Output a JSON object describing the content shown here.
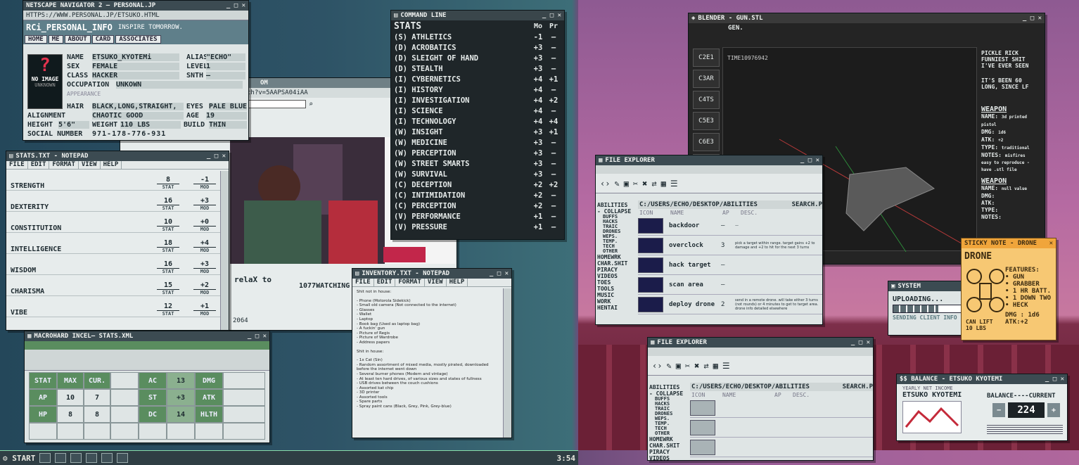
{
  "navigator": {
    "title": "NETSCAPE NAVIGATOR 2 — PERSONAL.JP",
    "url": "HTTPS://WWW.PERSONAL.JP/ETSUKO.HTML",
    "site": "RCi_PERSONAL_INFO",
    "tagline": "INSPIRE TOMORROW.",
    "nav": [
      "HOME",
      "ME",
      "ABOUT",
      "CARD",
      "ASSOCIATES"
    ],
    "noimage": "?",
    "noimage_label": "NO IMAGE",
    "unknown": "UNKNOWN",
    "fields": [
      {
        "k": "NAME",
        "v": "ETSUKO_KYOTEMi"
      },
      {
        "k": "SEX",
        "v": "FEMALE"
      },
      {
        "k": "CLASS",
        "v": "HACKER"
      },
      {
        "k": "OCCUPATION",
        "v": "UNKOWN"
      }
    ],
    "right_fields": [
      {
        "k": "ALIAS",
        "v": "\"ECHO\""
      },
      {
        "k": "LEVEL",
        "v": "1"
      },
      {
        "k": "SNTH",
        "v": "—"
      }
    ],
    "appearance": "APPEARANCE",
    "hair_k": "HAIR",
    "hair_v": "BLACK,LONG,STRAIGHT,",
    "eyes_k": "EYES",
    "eyes_v": "PALE BLUE",
    "align_k": "ALIGNMENT",
    "align_v": "CHAOTIC GOOD",
    "age_k": "AGE",
    "age_v": "19",
    "height_k": "HEIGHT",
    "height_v": "5'6\"",
    "weight_k": "WEIGHT",
    "weight_v": "110 LBS",
    "build_k": "BUILD",
    "build_v": "THIN",
    "social_k": "SOCIAL NUMBER",
    "social_v": "971-178-776-931"
  },
  "browser2": {
    "url": "ch?v=5AAPSA04iAA",
    "caption": "relaX to",
    "watching": "1077WATCHING",
    "views": "2064",
    "title_frag": "OM"
  },
  "notepad": {
    "title": "STATS.TXT - NOTEPAD",
    "menu": [
      "FILE",
      "EDIT",
      "FORMAT",
      "VIEW",
      "HELP"
    ],
    "stat_lbl": "STAT",
    "mod_lbl": "MOD",
    "rows": [
      {
        "n": "STRENGTH",
        "v": "8",
        "m": "-1"
      },
      {
        "n": "DEXTERITY",
        "v": "16",
        "m": "+3"
      },
      {
        "n": "CONSTITUTION",
        "v": "10",
        "m": "+0"
      },
      {
        "n": "INTELLIGENCE",
        "v": "18",
        "m": "+4"
      },
      {
        "n": "WISDOM",
        "v": "16",
        "m": "+3"
      },
      {
        "n": "CHARISMA",
        "v": "15",
        "m": "+2"
      },
      {
        "n": "VIBE",
        "v": "12",
        "m": "+1"
      }
    ]
  },
  "cmd": {
    "title": "COMMAND LINE",
    "head": "STATS",
    "col1": "Mo",
    "col2": "Pr",
    "rows": [
      {
        "n": "(S) ATHLETICS",
        "m": "-1",
        "p": "—"
      },
      {
        "n": "(D) ACROBATICS",
        "m": "+3",
        "p": "—"
      },
      {
        "n": "(D) SLEIGHT OF HAND",
        "m": "+3",
        "p": "—"
      },
      {
        "n": "(D) STEALTH",
        "m": "+3",
        "p": "—"
      },
      {
        "n": "(I) CYBERNETICS",
        "m": "+4",
        "p": "+1"
      },
      {
        "n": "(I) HISTORY",
        "m": "+4",
        "p": "—"
      },
      {
        "n": "(I) INVESTIGATION",
        "m": "+4",
        "p": "+2"
      },
      {
        "n": "(I) SCIENCE",
        "m": "+4",
        "p": "—"
      },
      {
        "n": "(I) TECHNOLOGY",
        "m": "+4",
        "p": "+4"
      },
      {
        "n": "(W) INSIGHT",
        "m": "+3",
        "p": "+1"
      },
      {
        "n": "(W) MEDICINE",
        "m": "+3",
        "p": "—"
      },
      {
        "n": "(W) PERCEPTION",
        "m": "+3",
        "p": "—"
      },
      {
        "n": "(W) STREET SMARTS",
        "m": "+3",
        "p": "—"
      },
      {
        "n": "(W) SURVIVAL",
        "m": "+3",
        "p": "—"
      },
      {
        "n": "(C) DECEPTION",
        "m": "+2",
        "p": "+2"
      },
      {
        "n": "(C) INTIMIDATION",
        "m": "+2",
        "p": "—"
      },
      {
        "n": "(C) PERCEPTION",
        "m": "+2",
        "p": "—"
      },
      {
        "n": "(V) PERFORMANCE",
        "m": "+1",
        "p": "—"
      },
      {
        "n": "(V) PRESSURE",
        "m": "+1",
        "p": "—"
      }
    ]
  },
  "inventory": {
    "title": "INVENTORY.TXT - NOTEPAD",
    "menu": [
      "FILE",
      "EDIT",
      "FORMAT",
      "VIEW",
      "HELP"
    ],
    "lines": [
      "Shit not in house:",
      "",
      "- Phone (Motorola Sidekick)",
      "- Small old camera (Not connected to the internet)",
      "- Glasses",
      "- Wallet",
      "- Laptop",
      "- Book bag (Used as laptop bag)",
      "- A fuckin' gun",
      "- Picture of Regis",
      "- Picture of Wardrobe",
      "- Address papers",
      "",
      "Shit in house:",
      "",
      "- 1x Cat (Sin)",
      "- Random assortment of mixed media, mostly pirated, downloaded before the internet went down",
      "- Several burner phones (Modern and vintage)",
      "- At least ten hard drives, of various sizes and states of fullness",
      "- USB drives between the couch cushions",
      "- Assorted kat chip",
      "- 3D printer",
      "- Assorted tools",
      "- Spare parts",
      "- Spray paint cans (Black, Grey, Pink, Grey-blue)"
    ]
  },
  "spreadsheet": {
    "title": "MACROHARD INCEL— STATS.XML",
    "headers": [
      "STAT",
      "MAX",
      "CUR."
    ],
    "rows": [
      [
        "AP",
        "10",
        "7"
      ],
      [
        "HP",
        "8",
        "8"
      ]
    ],
    "right": [
      [
        "AC",
        "13",
        "DMG"
      ],
      [
        "ST",
        "+3",
        "ATK"
      ],
      [
        "DC",
        "14",
        "HLTH"
      ]
    ]
  },
  "taskbar": {
    "start": "START",
    "time": "3:54"
  },
  "blender": {
    "title": "BLENDER - GUN.STL",
    "gen": "GEN.",
    "time": "TIME10976942",
    "notes": [
      "PICKLE RICK",
      "FUNNIEST SHIT",
      "I'VE EVER SEEN",
      "IT'S BEEN 60",
      "LONG, SINCE LF"
    ],
    "side": [
      "C2E1",
      "C3AR",
      "C4TS",
      "C5E3",
      "C6E3",
      "C7RS",
      "C8RF",
      "C9E3",
      "C5E1"
    ],
    "w1": {
      "h": "WEAPON",
      "name": "3d printed pistol",
      "dmg": "1d6",
      "atk": "+2",
      "type": "traditional",
      "notes": "misfires"
    },
    "w1_extra": [
      "easy to reproduce -",
      "have .stl file"
    ],
    "w2": {
      "h": "WEAPON",
      "name": "null value"
    },
    "field_labels": [
      "NAME:",
      "DMG:",
      "ATK:",
      "TYPE:",
      "NOTES:"
    ]
  },
  "fe1": {
    "title": "FILE EXPLORER",
    "path": "C:/USERS/ECHO/DESKTOP/ABILITIES",
    "search": "SEARCH.P",
    "cols": [
      "ICON",
      "NAME",
      "AP",
      "DESC."
    ],
    "side": [
      "ABILITIES",
      "- COLLAPSE",
      "BUFFS",
      "HACKS",
      "TRAIC",
      "DRONES",
      "WEPS.",
      "TEMP.",
      "TECH",
      "OTHER",
      "HOMEWRK",
      "CHAR.SHIT",
      "PIRACY",
      "VIDEOS",
      "TOES",
      "TOOLS",
      "MUSIC",
      "WORK",
      "HENTAI"
    ],
    "rows": [
      {
        "n": "backdoor",
        "ap": "—",
        "d": "—"
      },
      {
        "n": "overclock",
        "ap": "3",
        "d": "pick a target within range. target gains +2 to damage and +2 to hit for the next 3 turns"
      },
      {
        "n": "hack target",
        "ap": "—",
        "d": ""
      },
      {
        "n": "scan area",
        "ap": "—",
        "d": ""
      },
      {
        "n": "deploy drone",
        "ap": "2",
        "d": "send in a remote drone. will take either 3 turns (not rounds) or 4 minutes to get to target area. drone info detailed elsewhere"
      }
    ]
  },
  "fe2": {
    "title": "FILE EXPLORER",
    "path": "C:/USERS/ECHO/DESKTOP/ABILITIES",
    "search": "SEARCH.P",
    "cols": [
      "ICON",
      "NAME",
      "AP",
      "DESC."
    ],
    "side": [
      "ABILITIES",
      "- COLLAPSE",
      "BUFFS",
      "HACKS",
      "TRAIC",
      "DRONES",
      "WEPS.",
      "TEMP.",
      "TECH",
      "OTHER",
      "HOMEWRK",
      "CHAR.SHIT",
      "PIRACY",
      "VIDEOS"
    ]
  },
  "sticky": {
    "title": "STICKY NOTE - DRONE",
    "head": "DRONE",
    "features": "FEATURES:",
    "items": [
      "• GUN",
      "• GRABBER",
      "• 1 HR BATT.",
      "• 1 DOWN TWO",
      "• HECK"
    ],
    "lift": "CAN LIFT",
    "lbs": "10 LBS",
    "dmg": "DMG : 1d6",
    "atk": "ATK:+2"
  },
  "system": {
    "title": "SYSTEM",
    "uploading": "UPLOADING...",
    "sending": "SENDING CLIENT INFO",
    "progress": 0.6
  },
  "balance": {
    "title": "$$ BALANCE - ETSUKO KYOTEMI",
    "sub": "YEARLY NET INCOME",
    "name": "ETSUKO KYOTEMI",
    "label": "BALANCE----CURRENT",
    "value": "224",
    "minus": "−",
    "plus": "+"
  }
}
